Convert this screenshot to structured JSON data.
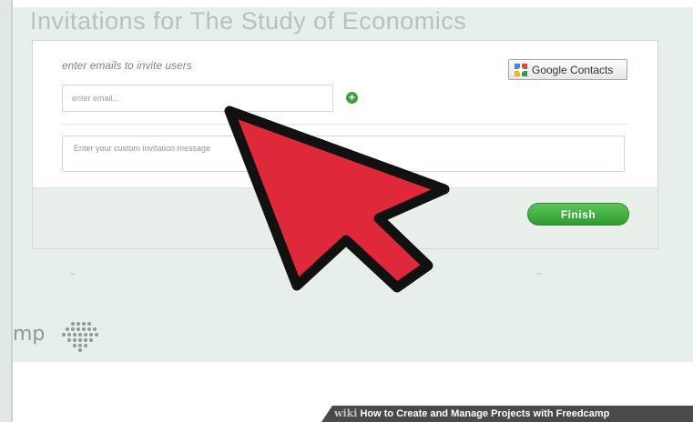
{
  "page": {
    "title": "Invitations for The Study of Economics"
  },
  "invite": {
    "label": "enter emails to invite users",
    "email_placeholder": "enter email...",
    "add_button": "+",
    "google_contacts_label": "Google Contacts",
    "message_placeholder": "Enter your custom invitation message",
    "finish_label": "Finish"
  },
  "branding": {
    "text": "mp"
  },
  "banner": {
    "wiki": "wiki",
    "text": "How to Create and Manage Projects with Freedcamp"
  },
  "colors": {
    "accent_green": "#3da33f",
    "pointer_red": "#e0283b",
    "background": "#e6efea"
  },
  "icons": {
    "add": "plus-circle-icon",
    "google_contacts": "google-contacts-icon",
    "pointer": "red-arrow-cursor-icon",
    "logo": "freedcamp-logo-icon"
  }
}
